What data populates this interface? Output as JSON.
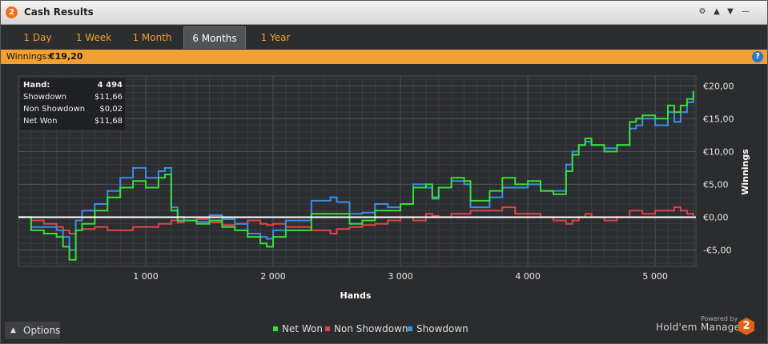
{
  "window": {
    "title": "Cash Results",
    "logo_text": "2"
  },
  "titlebar_buttons": {
    "gear": "⚙",
    "up": "▲",
    "down": "▼",
    "minimize": "—"
  },
  "tabs": [
    {
      "label": "1 Day",
      "active": false
    },
    {
      "label": "1 Week",
      "active": false
    },
    {
      "label": "1 Month",
      "active": false
    },
    {
      "label": "6 Months",
      "active": true
    },
    {
      "label": "1 Year",
      "active": false
    }
  ],
  "winnings_bar": {
    "label": "Winnings:",
    "value": "€19,20",
    "help": "?"
  },
  "tooltip": [
    {
      "label": "Hand:",
      "value": "4 494"
    },
    {
      "label": "Showdown",
      "value": "$11,66"
    },
    {
      "label": "Non Showdown",
      "value": "$0,02"
    },
    {
      "label": "Net Won",
      "value": "$11,68"
    }
  ],
  "options": {
    "label": "Options",
    "chevron": "▲"
  },
  "branding": {
    "powered": "Powered by",
    "name": "Hold'em Manager",
    "logo_text": "2"
  },
  "colors": {
    "net_won": "#35e035",
    "non_showdown": "#e04545",
    "showdown": "#3a8fe6",
    "accent": "#f0a132",
    "zero_line": "#ffffff"
  },
  "chart_data": {
    "type": "line",
    "xlabel": "Hands",
    "ylabel": "Winnings",
    "xlim": [
      0,
      5320
    ],
    "ylim": [
      -7.5,
      21.5
    ],
    "x_ticks": [
      1000,
      2000,
      3000,
      4000,
      5000
    ],
    "x_tick_labels": [
      "1 000",
      "2 000",
      "3 000",
      "4 000",
      "5 000"
    ],
    "y_ticks": [
      -5,
      0,
      5,
      10,
      15,
      20
    ],
    "y_tick_labels": [
      "-€5,00",
      "€0,00",
      "€5,00",
      "€10,00",
      "€15,00",
      "€20,00"
    ],
    "grid": true,
    "legend_position": "bottom-center",
    "x": [
      0,
      100,
      200,
      300,
      350,
      400,
      450,
      500,
      600,
      700,
      800,
      900,
      1000,
      1100,
      1150,
      1200,
      1250,
      1300,
      1400,
      1500,
      1600,
      1700,
      1800,
      1900,
      1950,
      2000,
      2100,
      2200,
      2300,
      2400,
      2450,
      2500,
      2600,
      2700,
      2800,
      2900,
      3000,
      3100,
      3200,
      3250,
      3300,
      3400,
      3500,
      3550,
      3600,
      3700,
      3800,
      3900,
      4000,
      4100,
      4200,
      4300,
      4350,
      4400,
      4450,
      4500,
      4600,
      4700,
      4800,
      4850,
      4900,
      5000,
      5100,
      5150,
      5200,
      5250,
      5300
    ],
    "series": [
      {
        "name": "Net Won",
        "values": [
          0,
          -2,
          -2.5,
          -3,
          -4.5,
          -6.5,
          -2,
          -1,
          1,
          3,
          4.5,
          5.5,
          4.5,
          6,
          6.5,
          1,
          -0.5,
          -0.5,
          -1,
          -0.5,
          -1.5,
          -2,
          -3,
          -4,
          -4.5,
          -3,
          -2,
          -2,
          0.5,
          0.5,
          0.5,
          0.5,
          -1,
          -0.5,
          1,
          1,
          2,
          4.5,
          5,
          3,
          4.5,
          6,
          5.5,
          2.5,
          2.5,
          4,
          6,
          5,
          5.5,
          4,
          3.5,
          7,
          9.5,
          11,
          12,
          11,
          10,
          11,
          14.5,
          15,
          15.5,
          15,
          17,
          16,
          17,
          18,
          19.2
        ]
      },
      {
        "name": "Non Showdown",
        "values": [
          0,
          -0.5,
          -1,
          -1.5,
          -2,
          -2.5,
          -2,
          -1.8,
          -1.5,
          -2,
          -2,
          -1.5,
          -1.5,
          -1,
          -1,
          -0.5,
          -0.8,
          -0.5,
          -0.3,
          -0.8,
          -1.2,
          -1,
          -0.5,
          -1,
          -1.2,
          -1,
          -1.5,
          -1.5,
          -2,
          -2,
          -2.5,
          -1.8,
          -1.5,
          -1.2,
          -1,
          -0.5,
          0,
          -0.5,
          0.5,
          0.2,
          0,
          0.5,
          0.5,
          1,
          1,
          1,
          1.5,
          0.5,
          0.5,
          0,
          -0.5,
          -1,
          -0.5,
          0,
          0.5,
          0,
          -0.5,
          0,
          1,
          1,
          0.5,
          1,
          1,
          1.5,
          1,
          0.5,
          0.2
        ]
      },
      {
        "name": "Showdown",
        "values": [
          0,
          -1.5,
          -1.5,
          -2,
          -3,
          -5,
          -0.5,
          1,
          2,
          4,
          6,
          7.5,
          6,
          7,
          7.5,
          1.5,
          0,
          -0.5,
          -0.7,
          0.3,
          -0.3,
          -1,
          -2.5,
          -3,
          -3.3,
          -2,
          -0.5,
          -0.5,
          2.5,
          2.5,
          3,
          2.3,
          0.5,
          0.7,
          2,
          1.5,
          2,
          5,
          4.5,
          2.8,
          4.5,
          5.5,
          5,
          1.5,
          1.5,
          3,
          4.5,
          4.5,
          5,
          4,
          4,
          8,
          10,
          11,
          11.5,
          11,
          10.5,
          11,
          13.5,
          14,
          15,
          14,
          16,
          14.5,
          16,
          17.5,
          19
        ]
      }
    ]
  }
}
